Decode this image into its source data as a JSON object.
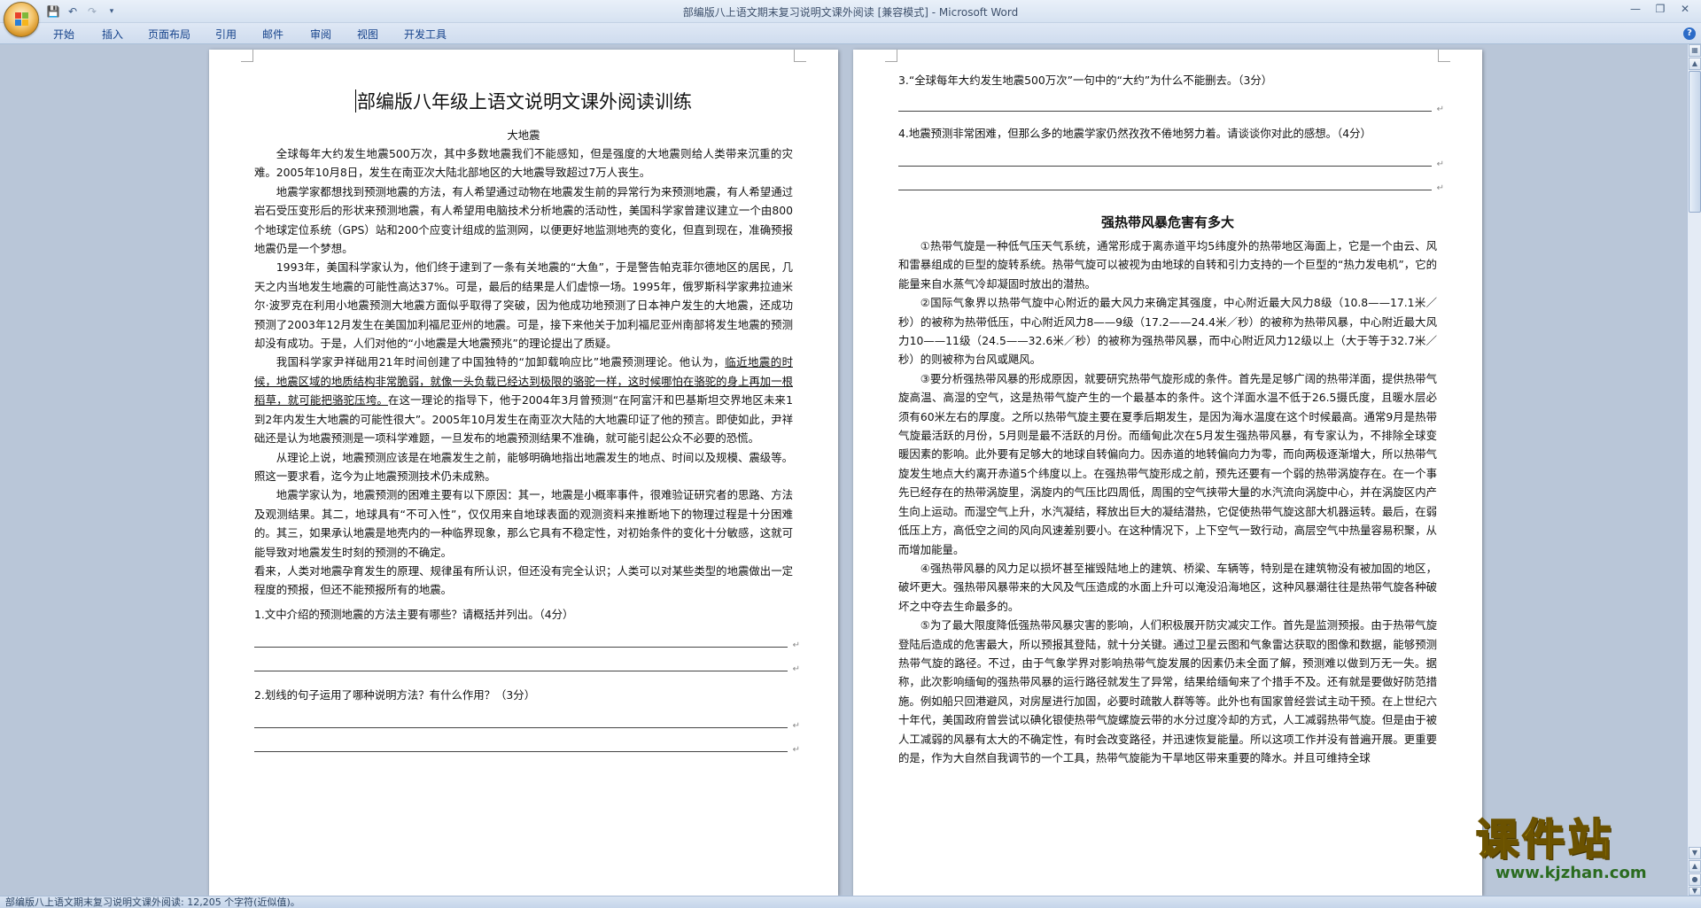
{
  "window": {
    "title": "部编版八上语文期末复习说明文课外阅读 [兼容模式] - Microsoft Word"
  },
  "ribbon": {
    "tabs": [
      "开始",
      "插入",
      "页面布局",
      "引用",
      "邮件",
      "审阅",
      "视图",
      "开发工具"
    ]
  },
  "left_page": {
    "doc_title": "部编版八年级上语文说明文课外阅读训练",
    "section_title": "大地震",
    "paragraphs": [
      "全球每年大约发生地震500万次，其中多数地震我们不能感知，但是强度的大地震则给人类带来沉重的灾难。2005年10月8日，发生在南亚次大陆北部地区的大地震导致超过7万人丧生。",
      "地震学家都想找到预测地震的方法，有人希望通过动物在地震发生前的异常行为来预测地震，有人希望通过岩石受压变形后的形状来预测地震，有人希望用电脑技术分析地震的活动性，美国科学家曾建议建立一个由800个地球定位系统（GPS）站和200个应变计组成的监测网，以便更好地监测地壳的变化，但直到现在，准确预报地震仍是一个梦想。",
      "1993年，美国科学家认为，他们终于逮到了一条有关地震的“大鱼”，于是警告帕克菲尔德地区的居民，几天之内当地发生地震的可能性高达37%。可是，最后的结果是人们虚惊一场。1995年，俄罗斯科学家弗拉迪米尔·波罗克在利用小地震预测大地震方面似乎取得了突破，因为他成功地预测了日本神户发生的大地震，还成功预测了2003年12月发生在美国加利福尼亚州的地震。可是，接下来他关于加利福尼亚州南部将发生地震的预测却没有成功。于是，人们对他的“小地震是大地震预兆”的理论提出了质疑。"
    ],
    "para4_before": "我国科学家尹祥础用21年时间创建了中国独特的“加卸载响应比”地震预测理论。他认为，",
    "para4_underlined": "临近地震的时候，地震区域的地质结构非常脆弱，就像一头负载已经达到极限的骆驼一样，这时候哪怕在骆驼的身上再加一根稻草，就可能把骆驼压垮。",
    "para4_after": "在这一理论的指导下，他于2004年3月曾预测“在阿富汗和巴基斯坦交界地区未来1到2年内发生大地震的可能性很大”。2005年10月发生在南亚次大陆的大地震印证了他的预言。即使如此，尹祥础还是认为地震预测是一项科学难题，一旦发布的地震预测结果不准确，就可能引起公众不必要的恐慌。",
    "paragraphs2": [
      "从理论上说，地震预测应该是在地震发生之前，能够明确地指出地震发生的地点、时间以及规模、震级等。照这一要求看，迄今为止地震预测技术仍未成熟。",
      "地震学家认为，地震预测的困难主要有以下原因：其一，地震是小概率事件，很难验证研究者的思路、方法及观测结果。其二，地球具有“不可入性”，仅仅用来自地球表面的观测资料来推断地下的物理过程是十分困难的。其三，如果承认地震是地壳内的一种临界现象，那么它具有不稳定性，对初始条件的变化十分敏感，这就可能导致对地震发生时刻的预测的不确定。"
    ],
    "closing": "看来，人类对地震孕育发生的原理、规律虽有所认识，但还没有完全认识；人类可以对某些类型的地震做出一定程度的预报，但还不能预报所有的地震。",
    "q1": "1.文中介绍的预测地震的方法主要有哪些？请概括并列出。（4分）",
    "q2": "2.划线的句子运用了哪种说明方法？有什么作用？（3分）"
  },
  "right_page": {
    "q3": "3.“全球每年大约发生地震500万次”一句中的“大约”为什么不能删去。（3分）",
    "q4": "4.地震预测非常困难，但那么多的地震学家仍然孜孜不倦地努力着。请谈谈你对此的感想。（4分）",
    "article_title": "强热带风暴危害有多大",
    "paragraphs": [
      "①热带气旋是一种低气压天气系统，通常形成于离赤道平均5纬度外的热带地区海面上，它是一个由云、风和雷暴组成的巨型的旋转系统。热带气旋可以被视为由地球的自转和引力支持的一个巨型的“热力发电机”，它的能量来自水蒸气冷却凝固时放出的潜热。",
      "②国际气象界以热带气旋中心附近的最大风力来确定其强度，中心附近最大风力8级（10.8——17.1米／秒）的被称为热带低压，中心附近风力8——9级（17.2——24.4米／秒）的被称为热带风暴，中心附近最大风力10——11级（24.5——32.6米／秒）的被称为强热带风暴，而中心附近风力12级以上（大于等于32.7米／秒）的则被称为台风或飓风。",
      "③要分析强热带风暴的形成原因，就要研究热带气旋形成的条件。首先是足够广阔的热带洋面，提供热带气旋高温、高湿的空气，这是热带气旋产生的一个最基本的条件。这个洋面水温不低于26.5摄氏度，且暖水层必须有60米左右的厚度。之所以热带气旋主要在夏季后期发生，是因为海水温度在这个时候最高。通常9月是热带气旋最活跃的月份，5月则是最不活跃的月份。而缅甸此次在5月发生强热带风暴，有专家认为，不排除全球变暖因素的影响。此外要有足够大的地球自转偏向力。因赤道的地转偏向力为零，而向两极逐渐增大，所以热带气旋发生地点大约离开赤道5个纬度以上。在强热带气旋形成之前，预先还要有一个弱的热带涡旋存在。在一个事先已经存在的热带涡旋里，涡旋内的气压比四周低，周围的空气挟带大量的水汽流向涡旋中心，并在涡旋区内产生向上运动。而湿空气上升，水汽凝结，释放出巨大的凝结潜热，它促使热带气旋这部大机器运转。最后，在弱低压上方，高低空之间的风向风速差别要小。在这种情况下，上下空气一致行动，高层空气中热量容易积聚，从而增加能量。",
      "④强热带风暴的风力足以损坏甚至摧毁陆地上的建筑、桥梁、车辆等，特别是在建筑物没有被加固的地区，破坏更大。强热带风暴带来的大风及气压造成的水面上升可以淹没沿海地区，这种风暴潮往往是热带气旋各种破坏之中夺去生命最多的。",
      "⑤为了最大限度降低强热带风暴灾害的影响，人们积极展开防灾减灾工作。首先是监测预报。由于热带气旋登陆后造成的危害最大，所以预报其登陆，就十分关键。通过卫星云图和气象雷达获取的图像和数据，能够预测热带气旋的路径。不过，由于气象学界对影响热带气旋发展的因素仍未全面了解，预测难以做到万无一失。据称，此次影响缅甸的强热带风暴的运行路径就发生了异常，结果给缅甸来了个措手不及。还有就是要做好防范措施。例如船只回港避风，对房屋进行加固，必要时疏散人群等等。此外也有国家曾经尝试主动干预。在上世纪六十年代，美国政府曾尝试以碘化银使热带气旋螺旋云带的水分过度冷却的方式，人工减弱热带气旋。但是由于被人工减弱的风暴有太大的不确定性，有时会改变路径，并迅速恢复能量。所以这项工作并没有普遍开展。更重要的是，作为大自然自我调节的一个工具，热带气旋能为干旱地区带来重要的降水。并且可维持全球"
    ]
  },
  "status_bar": {
    "text": "部编版八上语文期末复习说明文课外阅读: 12,205 个字符(近似值)。"
  },
  "watermark": {
    "cn": "课件站",
    "url": "www.kjzhan.com"
  },
  "icons": {
    "office": "office-button-icon",
    "save": "save-icon",
    "undo": "undo-icon",
    "redo": "redo-icon",
    "help": "help-icon"
  }
}
